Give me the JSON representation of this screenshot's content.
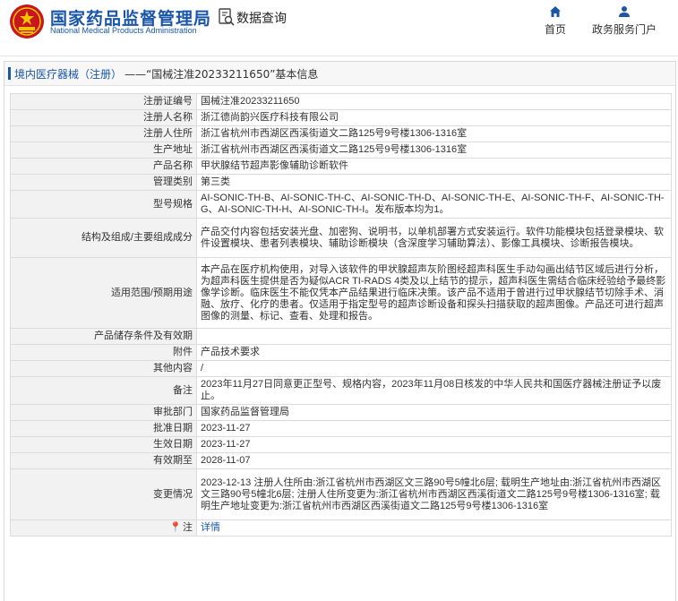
{
  "header": {
    "title": "国家药品监督管理局",
    "subtitle": "National Medical Products Administration",
    "query_label": "数据查询",
    "nav": {
      "home": "首页",
      "portal": "政务服务门户"
    },
    "brand_color": "#1a56a8",
    "emblem_color": "#c8161d"
  },
  "breadcrumb": {
    "link": "境内医疗器械（注册）",
    "text": "——“国械注准20233211650”基本信息"
  },
  "rows": [
    {
      "label": "注册证编号",
      "value": "国械注准20233211650"
    },
    {
      "label": "注册人名称",
      "value": "浙江德尚韵兴医疗科技有限公司"
    },
    {
      "label": "注册人住所",
      "value": "浙江省杭州市西湖区西溪街道文二路125号9号楼1306-1316室"
    },
    {
      "label": "生产地址",
      "value": "浙江省杭州市西湖区西溪街道文二路125号9号楼1306-1316室"
    },
    {
      "label": "产品名称",
      "value": "甲状腺结节超声影像辅助诊断软件"
    },
    {
      "label": "管理类别",
      "value": "第三类"
    },
    {
      "label": "型号规格",
      "value": "AI-SONIC-TH-B、AI-SONIC-TH-C、AI-SONIC-TH-D、AI-SONIC-TH-E、AI-SONIC-TH-F、AI-SONIC-TH-G、AI-SONIC-TH-H、AI-SONIC-TH-I。发布版本均为1。"
    },
    {
      "label": "结构及组成/主要组成成分",
      "value": "产品交付内容包括安装光盘、加密狗、说明书，以单机部署方式安装运行。软件功能模块包括登录模块、软件设置模块、患者列表模块、辅助诊断模块（含深度学习辅助算法）、影像工具模块、诊断报告模块。"
    },
    {
      "label": "适用范围/预期用途",
      "value": "本产品在医疗机构使用，对导入该软件的甲状腺超声灰阶图经超声科医生手动勾画出结节区域后进行分析，为超声科医生提供是否为疑似ACR TI-RADS 4类及以上结节的提示，超声科医生需结合临床经验给予最终影像学诊断。临床医生不能仅凭本产品结果进行临床决策。该产品不适用于曾进行过甲状腺结节切除手术、消融、放疗、化疗的患者。仅适用于指定型号的超声诊断设备和探头扫描获取的超声图像。产品还可进行超声图像的测量、标记、查看、处理和报告。"
    },
    {
      "label": "产品储存条件及有效期",
      "value": ""
    },
    {
      "label": "附件",
      "value": "产品技术要求"
    },
    {
      "label": "其他内容",
      "value": "/"
    },
    {
      "label": "备注",
      "value": "2023年11月27日同意更正型号、规格内容，2023年11月08日核发的中华人民共和国医疗器械注册证予以废止。"
    },
    {
      "label": "审批部门",
      "value": "国家药品监督管理局"
    },
    {
      "label": "批准日期",
      "value": "2023-11-27"
    },
    {
      "label": "生效日期",
      "value": "2023-11-27"
    },
    {
      "label": "有效期至",
      "value": "2028-11-07"
    },
    {
      "label": "变更情况",
      "value": "2023-12-13 注册人住所由:浙江省杭州市西湖区文三路90号5幢北6层; 载明生产地址由:浙江省杭州市西湖区文三路90号5幢北6层; 注册人住所变更为:浙江省杭州市西湖区西溪街道文二路125号9号楼1306-1316室; 载明生产地址变更为:浙江省杭州市西湖区西溪街道文二路125号9号楼1306-1316室"
    }
  ],
  "note": {
    "icon": "pin-icon",
    "label": "注",
    "link": "详情"
  }
}
